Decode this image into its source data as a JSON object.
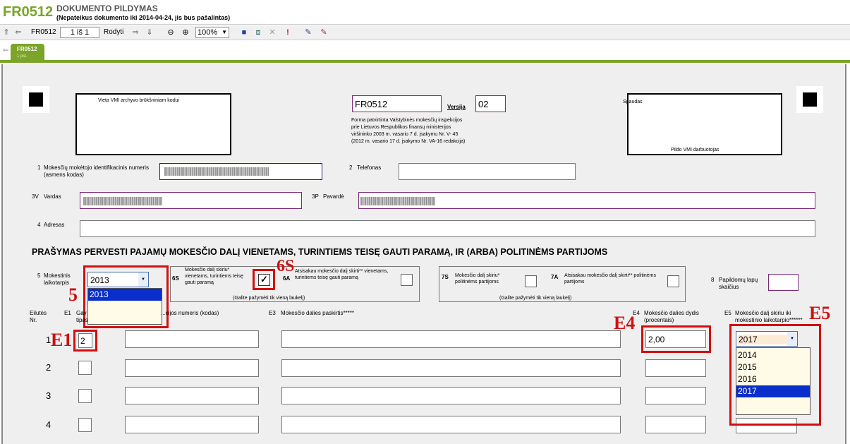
{
  "header": {
    "code": "FR0512",
    "title": "DOKUMENTO PILDYMAS",
    "subtitle": "(Nepateikus dokumento iki 2014-04-24, jis bus pašalintas)"
  },
  "toolbar": {
    "doc_code": "FR0512",
    "page_indicator": "1 iš 1",
    "show_label": "Rodyti",
    "zoom": "100%"
  },
  "tab": {
    "label": "FR0512",
    "sublabel": "1 psl."
  },
  "form": {
    "archive_box_label": "Vieta VMI archyvo brūkšniniam kodui",
    "form_code": "FR0512",
    "version_label": "Versija",
    "version_value": "02",
    "approval_text": [
      "Forma patvirtinta Valstybinės mokesčių inspekcijos",
      "prie Lietuvos Respublikos finansų ministerijos",
      "viršininko 2003 m. vasario 7 d. įsakymu Nr. V- 45",
      "(2012 m. vasario 17 d. įsakymo Nr. VA-16 redakcija)"
    ],
    "stamp_label": "Spaudas",
    "stamp_footer": "Pildo VMI darbuotojas",
    "f1_num": "1",
    "f1_label": "Mokesčių mokėtojo identifikacinis numeris",
    "f1_label2": "(asmens kodas)",
    "f2_num": "2",
    "f2_label": "Telefonas",
    "f3v_num": "3V",
    "f3v_label": "Vardas",
    "f3p_num": "3P",
    "f3p_label": "Pavardė",
    "f4_num": "4",
    "f4_label": "Adresas",
    "section_title": "PRAŠYMAS PERVESTI PAJAMŲ MOKESČIO DALĮ VIENETAMS, TURINTIEMS TEISĘ GAUTI PARAMĄ, IR (ARBA) POLITINĖMS PARTIJOMS",
    "f5_num": "5",
    "f5_label": "Mokestinis",
    "f5_label2": "laikotarpis",
    "f5_value": "2013",
    "f5_options": [
      "2013"
    ],
    "f6s_num": "6S",
    "f6s_label": "Mokesčio dalį skiriu* vienetams, turintiems teisę gauti paramą",
    "f6a_num": "6A",
    "f6a_label": "Atsisakau mokesčio dalį skirti** vienetams, turintiems teisę gauti paramą",
    "group_note": "(Galite pažymėti tik vieną laukelį)",
    "f7s_num": "7S",
    "f7s_label": "Mokesčio dalį skiriu* politinėms partijoms",
    "f7a_num": "7A",
    "f7a_label": "Atsisakau mokesčio dalį skirti** politinėms partijoms",
    "f8_num": "8",
    "f8_label": "Papildomų lapų",
    "f8_label2": "skaičius",
    "col_row": "Eilutės",
    "col_row2": "Nr.",
    "col_e1": "E1",
    "col_e1_label": "Gav",
    "col_e1_label2": "tipas",
    "col_e2_label": "...cijos numeris (kodas)",
    "col_e3": "E3",
    "col_e3_label": "Mokesčio dalies paskirtis*****",
    "col_e4": "E4",
    "col_e4_label": "Mokesčio dalies dydis",
    "col_e4_label2": "(procentais)",
    "col_e5": "E5",
    "col_e5_label": "Mokesčio dalį skiriu iki",
    "col_e5_label2": "mokestinio laikotarpio******",
    "rows": [
      {
        "n": "1",
        "e1": "2",
        "e4": "2,00"
      },
      {
        "n": "2",
        "e1": "",
        "e4": ""
      },
      {
        "n": "3",
        "e1": "",
        "e4": ""
      },
      {
        "n": "4",
        "e1": "",
        "e4": ""
      }
    ],
    "e5_value": "2017",
    "e5_options": [
      "2014",
      "2015",
      "2016",
      "2017"
    ]
  },
  "annotations": {
    "a5": "5",
    "a6s": "6S",
    "ae1": "E1",
    "ae4": "E4",
    "ae5": "E5"
  },
  "colors": {
    "brand_green": "#7ba428",
    "annotation_red": "#d01010",
    "select_blue": "#0a2ecb"
  }
}
